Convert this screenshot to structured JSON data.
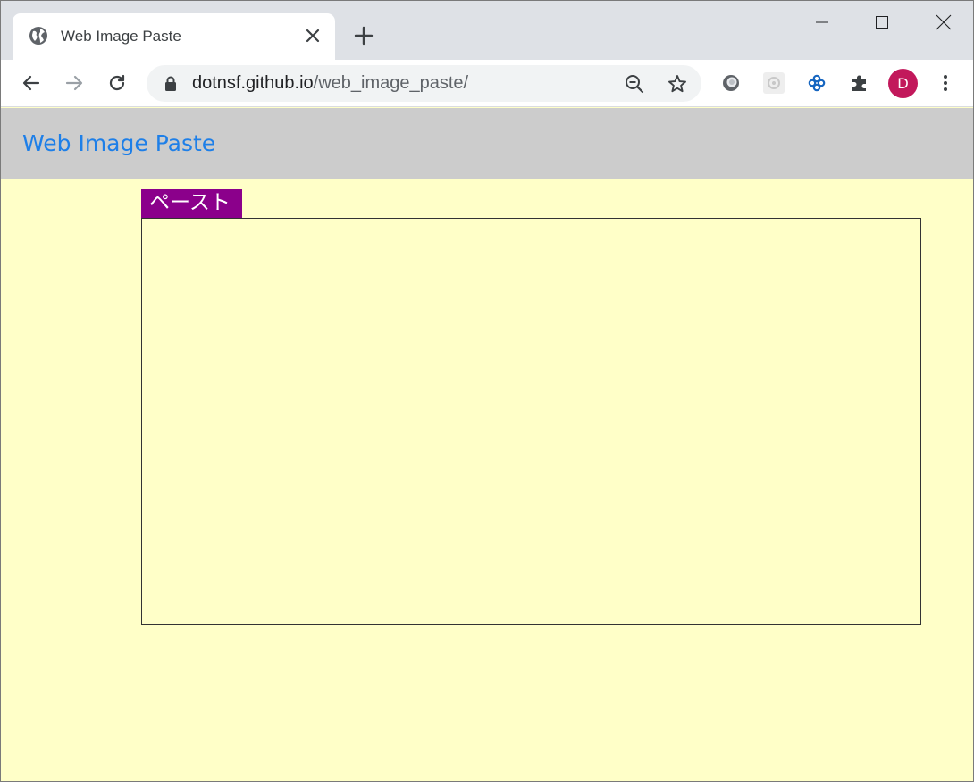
{
  "browser": {
    "tab_title": "Web Image Paste",
    "url_host": "dotnsf.github.io",
    "url_path": "/web_image_paste/",
    "avatar_letter": "D",
    "avatar_color": "#c2185b"
  },
  "page": {
    "title": "Web Image Paste",
    "paste_button_label": "ペースト",
    "colors": {
      "header_bg": "#cccccc",
      "title_link": "#1e7fe8",
      "page_bg": "#ffffc8",
      "button_bg": "#8b008b"
    }
  },
  "icons": {
    "tab_favicon": "globe-icon",
    "tab_close": "close-icon",
    "new_tab": "plus-icon",
    "back": "arrow-left-icon",
    "forward": "arrow-right-icon",
    "reload": "reload-icon",
    "lock": "lock-icon",
    "zoom": "zoom-out-icon",
    "bookmark": "star-icon",
    "extensions": [
      "extension-circle-icon",
      "extension-gear-icon",
      "extension-snowflake-icon",
      "puzzle-icon"
    ],
    "menu": "kebab-menu-icon"
  }
}
